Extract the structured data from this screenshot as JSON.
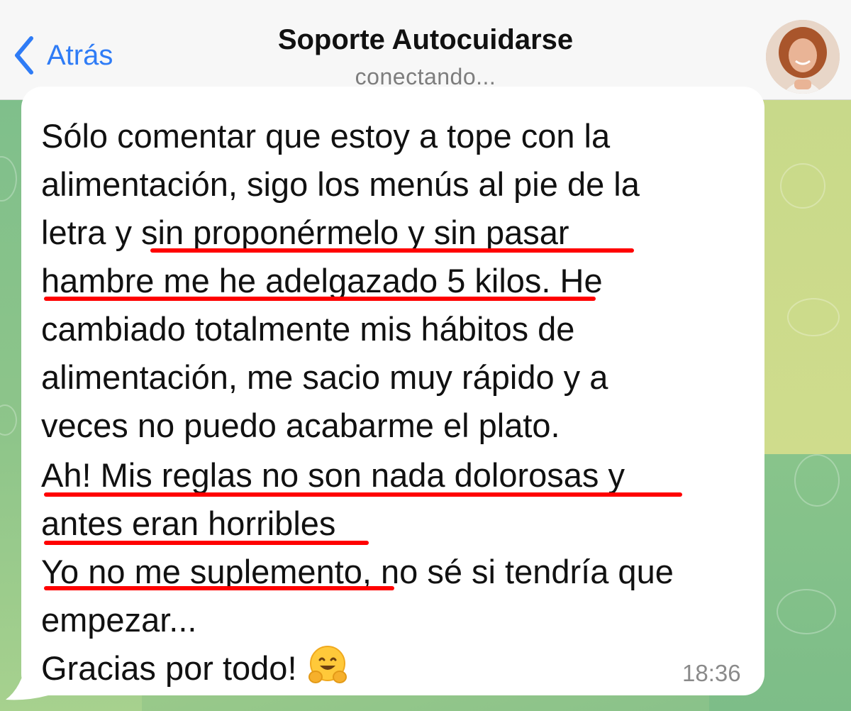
{
  "header": {
    "back_label": "Atrás",
    "title": "Soporte Autocuidarse",
    "status": "conectando..."
  },
  "message": {
    "lines": [
      "Sólo comentar que estoy a tope con la",
      "alimentación, sigo los menús al pie de la",
      "letra y sin proponérmelo y sin pasar",
      "hambre me he adelgazado 5 kilos. He",
      "cambiado totalmente mis hábitos de",
      "alimentación, me sacio muy rápido y a",
      "veces no puedo acabarme el plato.",
      "Ah! Mis reglas no son nada dolorosas y",
      "antes eran horribles",
      "Yo no me suplemento, no sé si tendría que",
      "empezar...",
      "Gracias por todo!"
    ],
    "emoji": "hugging-face",
    "time": "18:36",
    "highlight_color": "#ff0000"
  },
  "colors": {
    "accent": "#2f7cf6",
    "bubble": "#ffffff"
  }
}
